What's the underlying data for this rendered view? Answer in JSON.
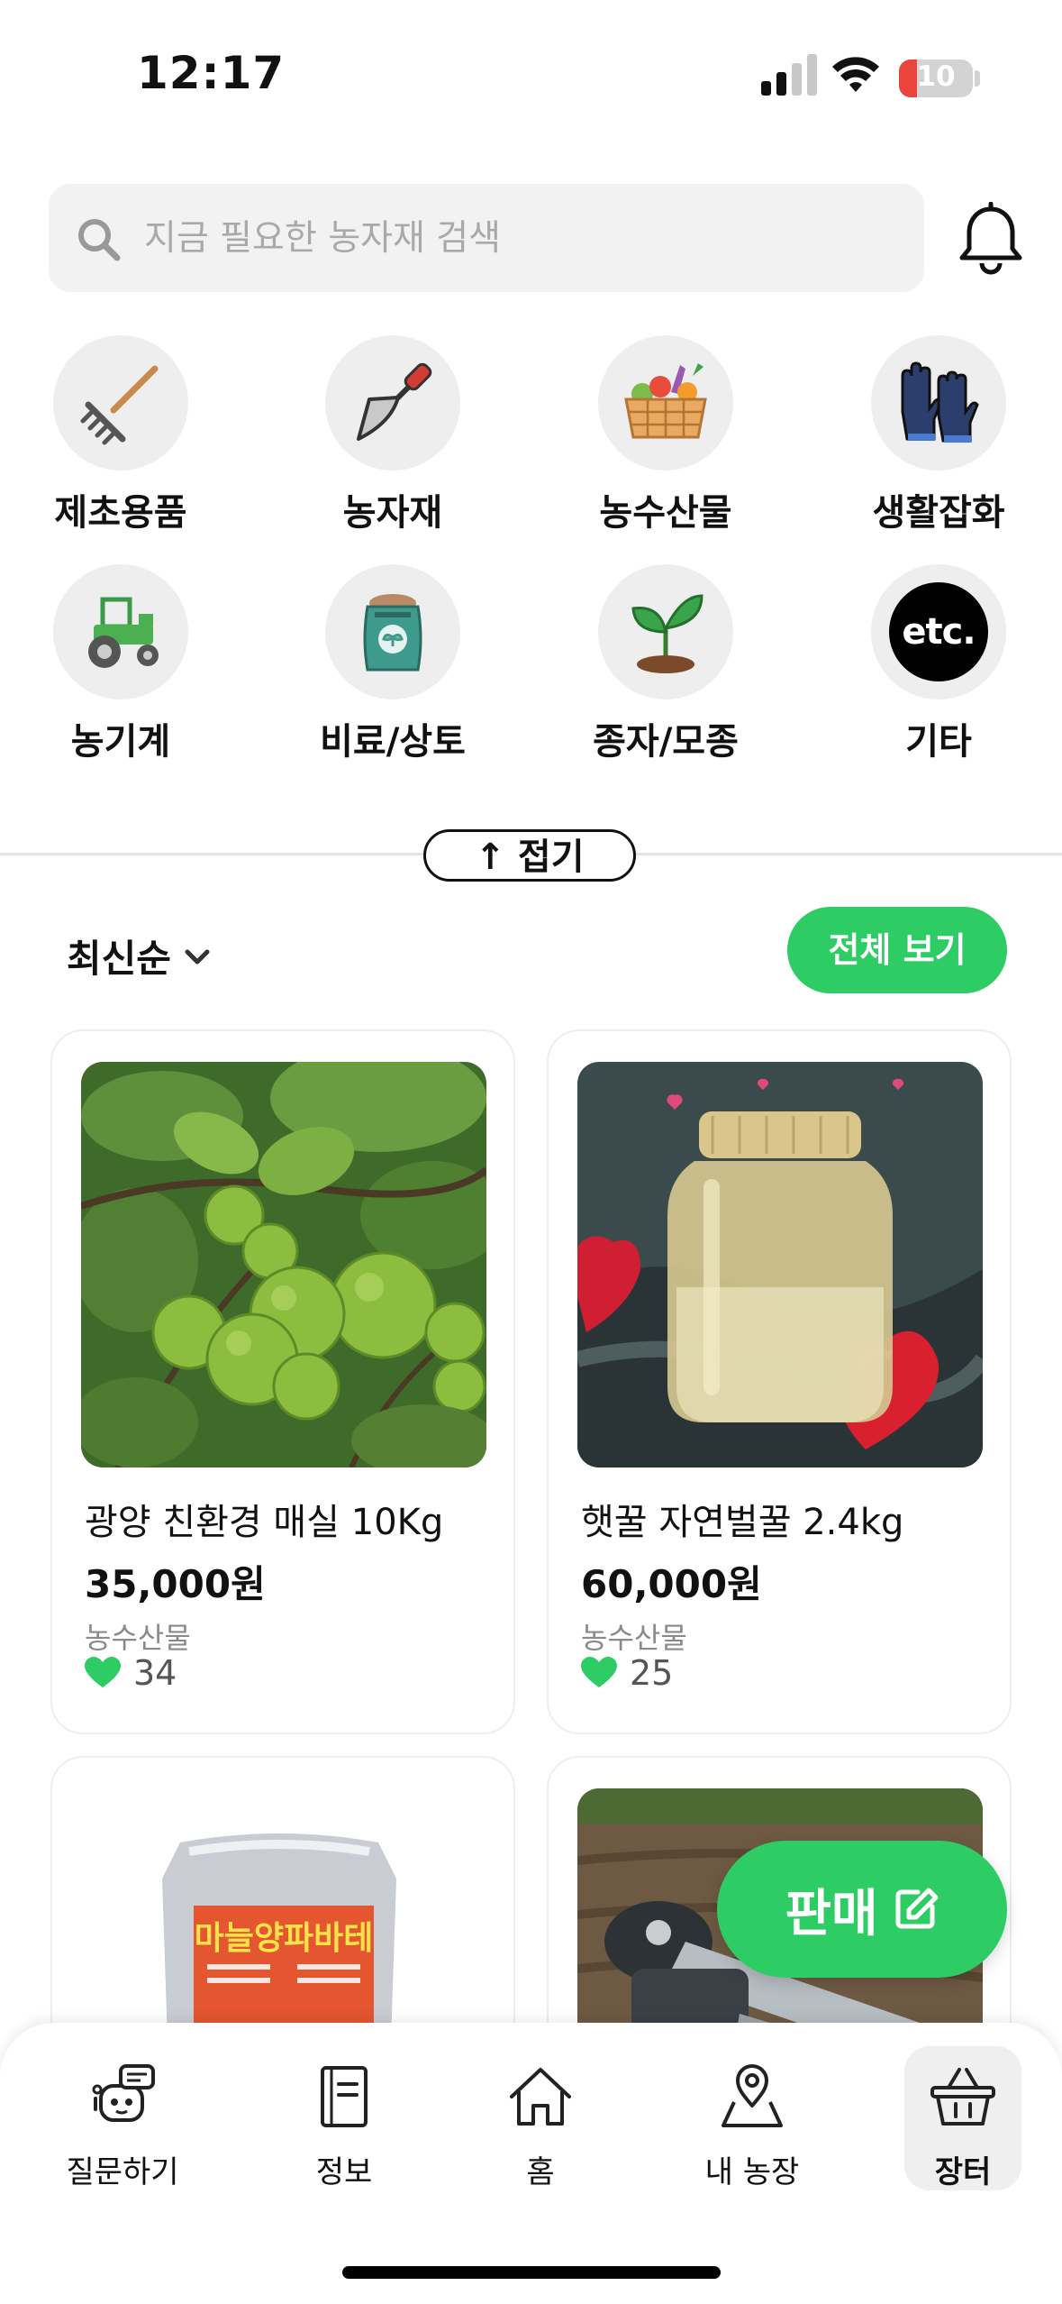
{
  "status_bar": {
    "time": "12:17",
    "battery": "10",
    "battery_level": 0.1
  },
  "search": {
    "placeholder": "지금 필요한 농자재 검색"
  },
  "categories": [
    {
      "label": "제초용품",
      "icon": "rake-icon"
    },
    {
      "label": "농자재",
      "icon": "trowel-icon"
    },
    {
      "label": "농수산물",
      "icon": "vegetable-basket-icon"
    },
    {
      "label": "생활잡화",
      "icon": "gloves-icon"
    },
    {
      "label": "농기계",
      "icon": "tractor-icon"
    },
    {
      "label": "비료/상토",
      "icon": "fertilizer-bag-icon"
    },
    {
      "label": "종자/모종",
      "icon": "sprout-icon"
    },
    {
      "label": "기타",
      "icon": "etc-icon",
      "badge": "etc."
    }
  ],
  "collapse_label": "↑ 접기",
  "sort": {
    "label": "최신순"
  },
  "view_all_label": "전체 보기",
  "products": [
    {
      "name": "광양 친환경 매실 10Kg",
      "price": "35,000원",
      "category": "농수산물",
      "likes": "34",
      "image": "green-plums-photo"
    },
    {
      "name": "햇꿀 자연벌꿀 2.4kg",
      "price": "60,000원",
      "category": "농수산물",
      "likes": "25",
      "image": "honey-jar-photo"
    },
    {
      "name": "",
      "image": "garlic-onion-package-photo",
      "package_text": "마늘양파바테"
    },
    {
      "name": "",
      "image": "farm-machine-photo"
    }
  ],
  "sell_label": "판매",
  "bottom_nav": [
    {
      "label": "질문하기",
      "icon": "robot-chat-icon"
    },
    {
      "label": "정보",
      "icon": "book-icon"
    },
    {
      "label": "홈",
      "icon": "home-icon"
    },
    {
      "label": "내 농장",
      "icon": "map-pin-icon"
    },
    {
      "label": "장터",
      "icon": "basket-icon",
      "active": true
    }
  ],
  "colors": {
    "accent": "#2ecc65",
    "heart": "#2ecc65",
    "battery_low": "#e8453c"
  }
}
